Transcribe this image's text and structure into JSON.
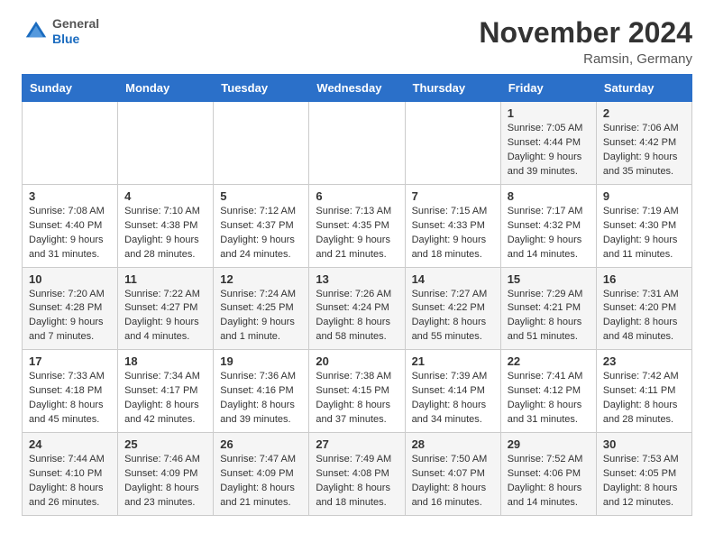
{
  "header": {
    "logo_line1": "General",
    "logo_line2": "Blue",
    "month_title": "November 2024",
    "location": "Ramsin, Germany"
  },
  "days_of_week": [
    "Sunday",
    "Monday",
    "Tuesday",
    "Wednesday",
    "Thursday",
    "Friday",
    "Saturday"
  ],
  "weeks": [
    [
      {
        "day": "",
        "info": ""
      },
      {
        "day": "",
        "info": ""
      },
      {
        "day": "",
        "info": ""
      },
      {
        "day": "",
        "info": ""
      },
      {
        "day": "",
        "info": ""
      },
      {
        "day": "1",
        "info": "Sunrise: 7:05 AM\nSunset: 4:44 PM\nDaylight: 9 hours and 39 minutes."
      },
      {
        "day": "2",
        "info": "Sunrise: 7:06 AM\nSunset: 4:42 PM\nDaylight: 9 hours and 35 minutes."
      }
    ],
    [
      {
        "day": "3",
        "info": "Sunrise: 7:08 AM\nSunset: 4:40 PM\nDaylight: 9 hours and 31 minutes."
      },
      {
        "day": "4",
        "info": "Sunrise: 7:10 AM\nSunset: 4:38 PM\nDaylight: 9 hours and 28 minutes."
      },
      {
        "day": "5",
        "info": "Sunrise: 7:12 AM\nSunset: 4:37 PM\nDaylight: 9 hours and 24 minutes."
      },
      {
        "day": "6",
        "info": "Sunrise: 7:13 AM\nSunset: 4:35 PM\nDaylight: 9 hours and 21 minutes."
      },
      {
        "day": "7",
        "info": "Sunrise: 7:15 AM\nSunset: 4:33 PM\nDaylight: 9 hours and 18 minutes."
      },
      {
        "day": "8",
        "info": "Sunrise: 7:17 AM\nSunset: 4:32 PM\nDaylight: 9 hours and 14 minutes."
      },
      {
        "day": "9",
        "info": "Sunrise: 7:19 AM\nSunset: 4:30 PM\nDaylight: 9 hours and 11 minutes."
      }
    ],
    [
      {
        "day": "10",
        "info": "Sunrise: 7:20 AM\nSunset: 4:28 PM\nDaylight: 9 hours and 7 minutes."
      },
      {
        "day": "11",
        "info": "Sunrise: 7:22 AM\nSunset: 4:27 PM\nDaylight: 9 hours and 4 minutes."
      },
      {
        "day": "12",
        "info": "Sunrise: 7:24 AM\nSunset: 4:25 PM\nDaylight: 9 hours and 1 minute."
      },
      {
        "day": "13",
        "info": "Sunrise: 7:26 AM\nSunset: 4:24 PM\nDaylight: 8 hours and 58 minutes."
      },
      {
        "day": "14",
        "info": "Sunrise: 7:27 AM\nSunset: 4:22 PM\nDaylight: 8 hours and 55 minutes."
      },
      {
        "day": "15",
        "info": "Sunrise: 7:29 AM\nSunset: 4:21 PM\nDaylight: 8 hours and 51 minutes."
      },
      {
        "day": "16",
        "info": "Sunrise: 7:31 AM\nSunset: 4:20 PM\nDaylight: 8 hours and 48 minutes."
      }
    ],
    [
      {
        "day": "17",
        "info": "Sunrise: 7:33 AM\nSunset: 4:18 PM\nDaylight: 8 hours and 45 minutes."
      },
      {
        "day": "18",
        "info": "Sunrise: 7:34 AM\nSunset: 4:17 PM\nDaylight: 8 hours and 42 minutes."
      },
      {
        "day": "19",
        "info": "Sunrise: 7:36 AM\nSunset: 4:16 PM\nDaylight: 8 hours and 39 minutes."
      },
      {
        "day": "20",
        "info": "Sunrise: 7:38 AM\nSunset: 4:15 PM\nDaylight: 8 hours and 37 minutes."
      },
      {
        "day": "21",
        "info": "Sunrise: 7:39 AM\nSunset: 4:14 PM\nDaylight: 8 hours and 34 minutes."
      },
      {
        "day": "22",
        "info": "Sunrise: 7:41 AM\nSunset: 4:12 PM\nDaylight: 8 hours and 31 minutes."
      },
      {
        "day": "23",
        "info": "Sunrise: 7:42 AM\nSunset: 4:11 PM\nDaylight: 8 hours and 28 minutes."
      }
    ],
    [
      {
        "day": "24",
        "info": "Sunrise: 7:44 AM\nSunset: 4:10 PM\nDaylight: 8 hours and 26 minutes."
      },
      {
        "day": "25",
        "info": "Sunrise: 7:46 AM\nSunset: 4:09 PM\nDaylight: 8 hours and 23 minutes."
      },
      {
        "day": "26",
        "info": "Sunrise: 7:47 AM\nSunset: 4:09 PM\nDaylight: 8 hours and 21 minutes."
      },
      {
        "day": "27",
        "info": "Sunrise: 7:49 AM\nSunset: 4:08 PM\nDaylight: 8 hours and 18 minutes."
      },
      {
        "day": "28",
        "info": "Sunrise: 7:50 AM\nSunset: 4:07 PM\nDaylight: 8 hours and 16 minutes."
      },
      {
        "day": "29",
        "info": "Sunrise: 7:52 AM\nSunset: 4:06 PM\nDaylight: 8 hours and 14 minutes."
      },
      {
        "day": "30",
        "info": "Sunrise: 7:53 AM\nSunset: 4:05 PM\nDaylight: 8 hours and 12 minutes."
      }
    ]
  ]
}
